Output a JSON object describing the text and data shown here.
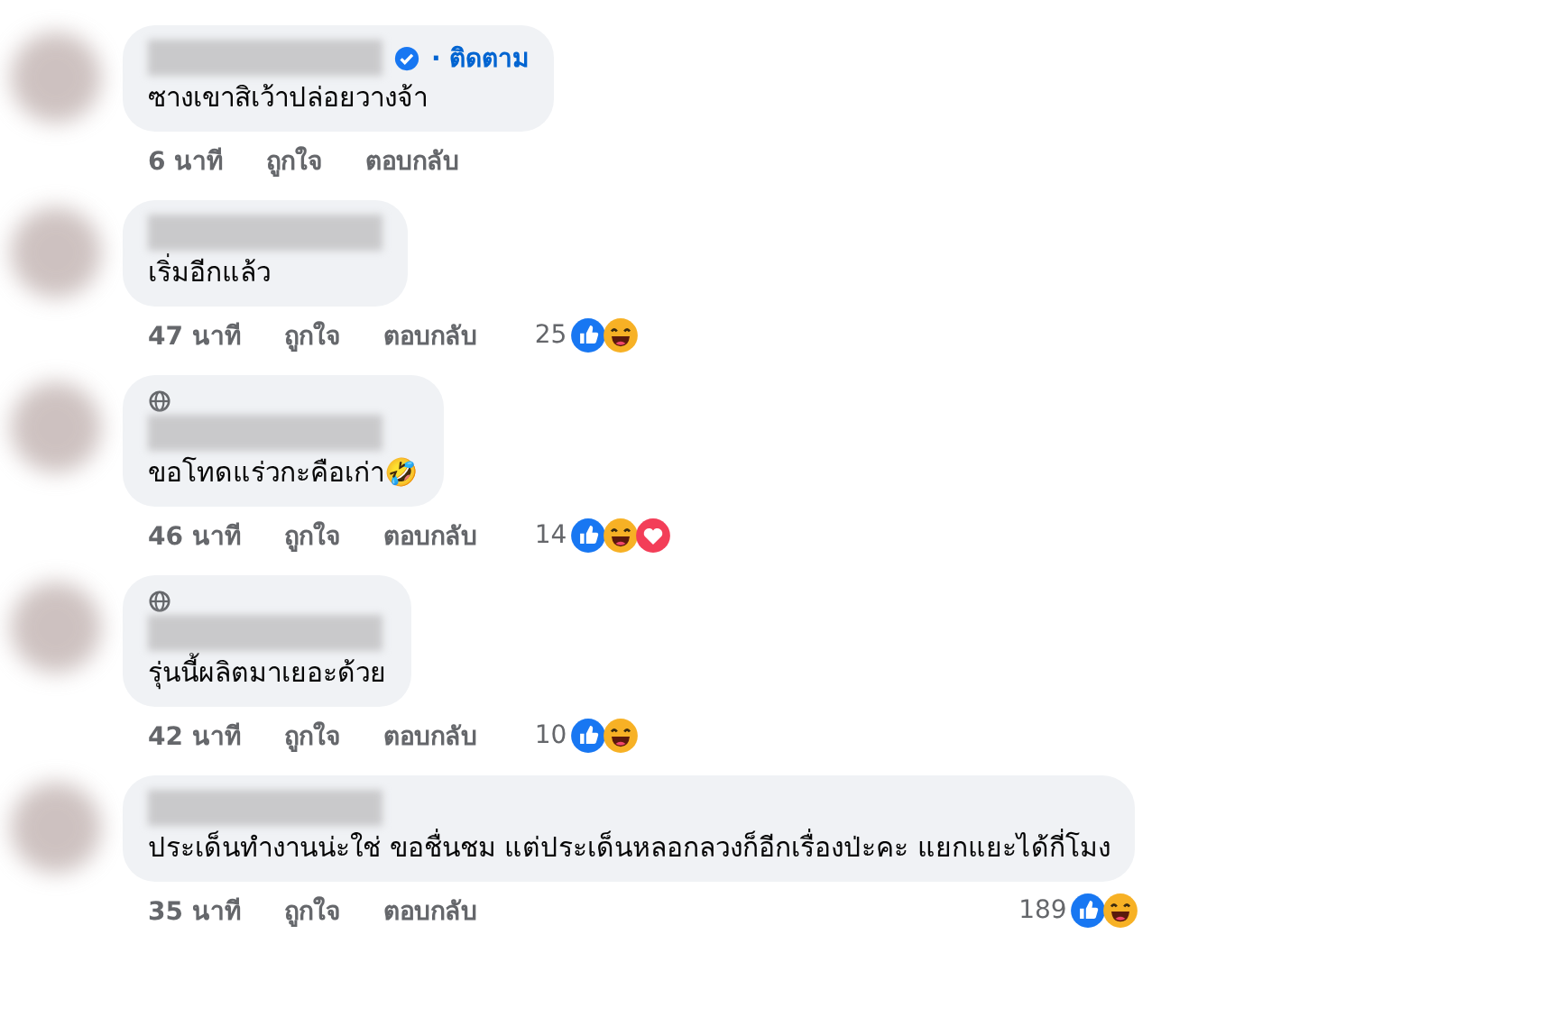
{
  "comments": [
    {
      "verified": true,
      "follow": "· ติดตาม",
      "fan_badge": false,
      "text": "ซางเขาสิเว้าปล่อยวางจ้า",
      "time": "6 นาที",
      "like": "ถูกใจ",
      "reply": "ตอบกลับ"
    },
    {
      "verified": false,
      "fan_badge": false,
      "text": "เริ่มอีกแล้ว",
      "time": "47 นาที",
      "like": "ถูกใจ",
      "reply": "ตอบกลับ",
      "reaction_count": "25",
      "reactions": [
        {
          "kind": "like"
        },
        {
          "kind": "haha"
        }
      ]
    },
    {
      "verified": false,
      "fan_badge": true,
      "text": "ขอโทดแร่วกะคือเก่า🤣",
      "time": "46 นาที",
      "like": "ถูกใจ",
      "reply": "ตอบกลับ",
      "reaction_count": "14",
      "reactions": [
        {
          "kind": "like"
        },
        {
          "kind": "haha"
        },
        {
          "kind": "love"
        }
      ]
    },
    {
      "verified": false,
      "fan_badge": true,
      "text": "รุ่นนี้ผลิตมาเยอะด้วย",
      "time": "42 นาที",
      "like": "ถูกใจ",
      "reply": "ตอบกลับ",
      "reaction_count": "10",
      "reactions": [
        {
          "kind": "like"
        },
        {
          "kind": "haha"
        }
      ]
    },
    {
      "verified": false,
      "fan_badge": false,
      "text": "ประเด็นทำงานน่ะใช่ ขอชื่นชม แต่ประเด็นหลอกลวงก็อีกเรื่องป่ะคะ แยกแยะได้กี่โมง",
      "time": "35 นาที",
      "like": "ถูกใจ",
      "reply": "ตอบกลับ",
      "reaction_count": "189",
      "reactions": [
        {
          "kind": "like"
        },
        {
          "kind": "haha"
        }
      ]
    }
  ]
}
